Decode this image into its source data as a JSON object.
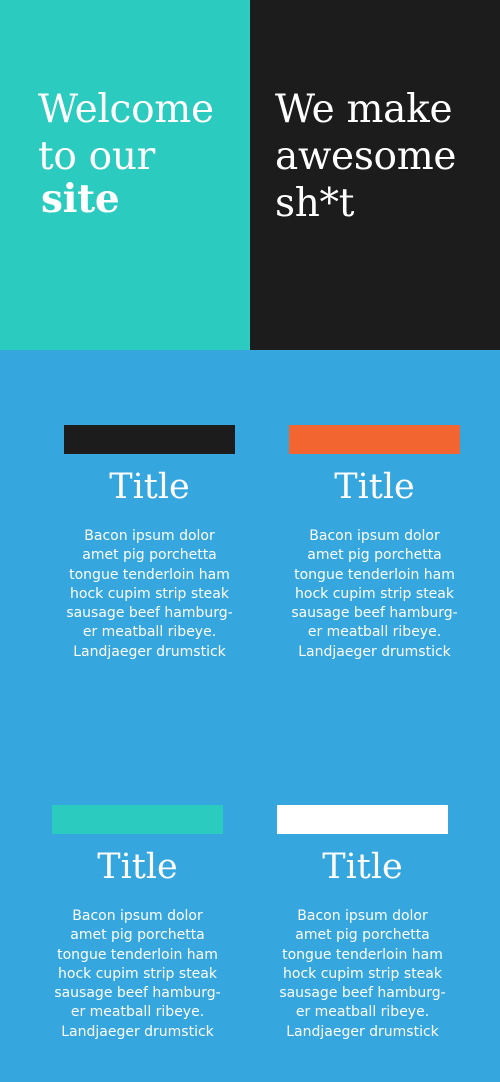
{
  "hero": {
    "left": {
      "lines": [
        "Welcome",
        "to our"
      ],
      "bold_word": "site",
      "background": "#2bcbc0"
    },
    "right": {
      "lines": [
        "We make",
        "awesome",
        "sh*t"
      ],
      "background": "#1c1c1d"
    }
  },
  "cards": [
    {
      "bar_color": "#1c1c1d",
      "title": "Title",
      "body_lines": [
        "Bacon ipsum dolor",
        "amet pig porchetta",
        "tongue tenderloin ham",
        "hock cupim strip steak",
        "sausage beef hamburg-",
        "er meatball ribeye.",
        "Landjaeger drumstick"
      ]
    },
    {
      "bar_color": "#f26531",
      "title": "Title",
      "body_lines": [
        "Bacon ipsum dolor",
        "amet pig porchetta",
        "tongue tenderloin ham",
        "hock cupim strip steak",
        "sausage beef hamburg-",
        "er meatball ribeye.",
        "Landjaeger drumstick"
      ]
    },
    {
      "bar_color": "#2bcbc0",
      "title": "Title",
      "body_lines": [
        "Bacon ipsum dolor",
        "amet pig porchetta",
        "tongue tenderloin ham",
        "hock cupim strip steak",
        "sausage beef hamburg-",
        "er meatball ribeye.",
        "Landjaeger drumstick"
      ]
    },
    {
      "bar_color": "#ffffff",
      "title": "Title",
      "body_lines": [
        "Bacon ipsum dolor",
        "amet pig porchetta",
        "tongue tenderloin ham",
        "hock cupim strip steak",
        "sausage beef hamburg-",
        "er meatball ribeye.",
        "Landjaeger drumstick"
      ]
    }
  ],
  "colors": {
    "page_background": "#35a6de",
    "text": "#ffffff"
  }
}
